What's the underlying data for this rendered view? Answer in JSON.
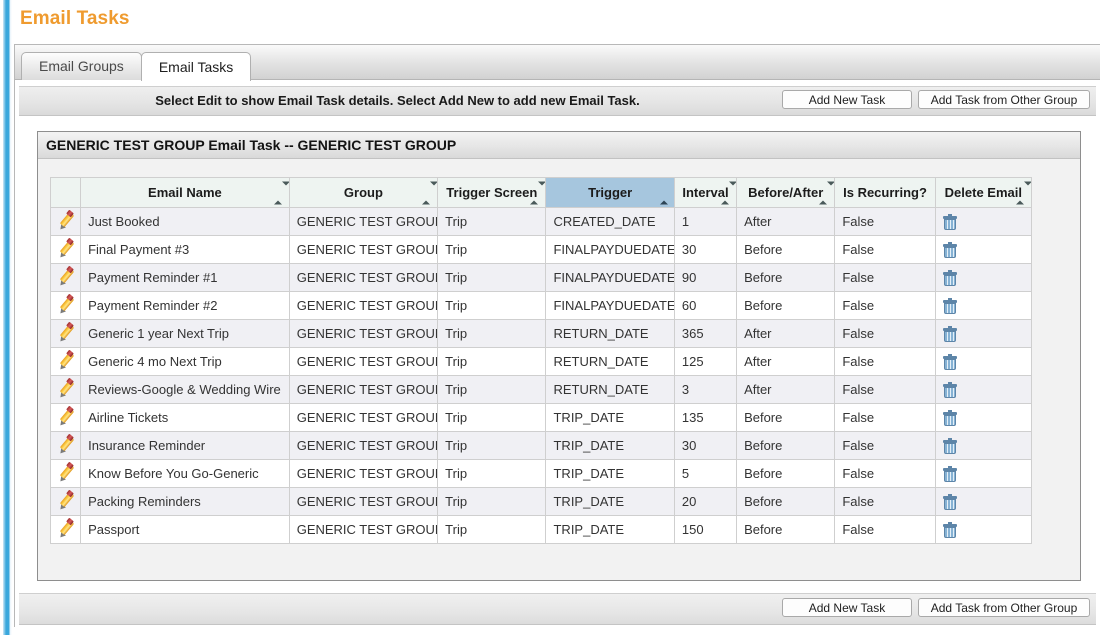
{
  "page": {
    "title": "Email Tasks"
  },
  "tabs": [
    {
      "label": "Email Groups",
      "active": false
    },
    {
      "label": "Email Tasks",
      "active": true
    }
  ],
  "instruction": {
    "text": "Select Edit to show Email Task details. Select Add New to add new Email Task."
  },
  "actions": {
    "add_new_task": "Add New Task",
    "add_task_other_group": "Add Task from Other Group"
  },
  "groupbox": {
    "title": "GENERIC TEST GROUP Email Task -- GENERIC TEST GROUP"
  },
  "table": {
    "columns": [
      {
        "key": "edit",
        "label": "",
        "sortable": false
      },
      {
        "key": "name",
        "label": "Email Name",
        "sortable": true,
        "sorted": false
      },
      {
        "key": "group",
        "label": "Group",
        "sortable": true,
        "sorted": false
      },
      {
        "key": "screen",
        "label": "Trigger Screen",
        "sortable": true,
        "sorted": false
      },
      {
        "key": "trig",
        "label": "Trigger",
        "sortable": true,
        "sorted": true,
        "direction": "asc"
      },
      {
        "key": "int",
        "label": "Interval",
        "sortable": true,
        "sorted": false
      },
      {
        "key": "ba",
        "label": "Before/After",
        "sortable": true,
        "sorted": false
      },
      {
        "key": "rec",
        "label": "Is Recurring?",
        "sortable": false,
        "sorted": false
      },
      {
        "key": "del",
        "label": "Delete Email",
        "sortable": true,
        "sorted": false
      }
    ],
    "rows": [
      {
        "name": "Just Booked",
        "group": "GENERIC TEST GROUP",
        "screen": "Trip",
        "trigger": "CREATED_DATE",
        "interval": "1",
        "before_after": "After",
        "recurring": "False"
      },
      {
        "name": "Final Payment #3",
        "group": "GENERIC TEST GROUP",
        "screen": "Trip",
        "trigger": "FINALPAYDUEDATE",
        "interval": "30",
        "before_after": "Before",
        "recurring": "False"
      },
      {
        "name": "Payment Reminder #1",
        "group": "GENERIC TEST GROUP",
        "screen": "Trip",
        "trigger": "FINALPAYDUEDATE",
        "interval": "90",
        "before_after": "Before",
        "recurring": "False"
      },
      {
        "name": "Payment Reminder #2",
        "group": "GENERIC TEST GROUP",
        "screen": "Trip",
        "trigger": "FINALPAYDUEDATE",
        "interval": "60",
        "before_after": "Before",
        "recurring": "False"
      },
      {
        "name": "Generic 1 year Next Trip",
        "group": "GENERIC TEST GROUP",
        "screen": "Trip",
        "trigger": "RETURN_DATE",
        "interval": "365",
        "before_after": "After",
        "recurring": "False"
      },
      {
        "name": "Generic 4 mo Next Trip",
        "group": "GENERIC TEST GROUP",
        "screen": "Trip",
        "trigger": "RETURN_DATE",
        "interval": "125",
        "before_after": "After",
        "recurring": "False"
      },
      {
        "name": "Reviews-Google & Wedding Wire",
        "group": "GENERIC TEST GROUP",
        "screen": "Trip",
        "trigger": "RETURN_DATE",
        "interval": "3",
        "before_after": "After",
        "recurring": "False"
      },
      {
        "name": "Airline Tickets",
        "group": "GENERIC TEST GROUP",
        "screen": "Trip",
        "trigger": "TRIP_DATE",
        "interval": "135",
        "before_after": "Before",
        "recurring": "False"
      },
      {
        "name": "Insurance Reminder",
        "group": "GENERIC TEST GROUP",
        "screen": "Trip",
        "trigger": "TRIP_DATE",
        "interval": "30",
        "before_after": "Before",
        "recurring": "False"
      },
      {
        "name": "Know Before You Go-Generic",
        "group": "GENERIC TEST GROUP",
        "screen": "Trip",
        "trigger": "TRIP_DATE",
        "interval": "5",
        "before_after": "Before",
        "recurring": "False"
      },
      {
        "name": "Packing Reminders",
        "group": "GENERIC TEST GROUP",
        "screen": "Trip",
        "trigger": "TRIP_DATE",
        "interval": "20",
        "before_after": "Before",
        "recurring": "False"
      },
      {
        "name": "Passport",
        "group": "GENERIC TEST GROUP",
        "screen": "Trip",
        "trigger": "TRIP_DATE",
        "interval": "150",
        "before_after": "Before",
        "recurring": "False"
      }
    ]
  },
  "icons": {
    "edit": "pencil-icon",
    "delete": "trash-icon"
  },
  "colors": {
    "title": "#ef9b2f",
    "sorted_header": "#a6c6de",
    "header": "#eef4f1",
    "row_odd": "#f0f0f4",
    "accent_stripe": "#3aa7dc"
  }
}
